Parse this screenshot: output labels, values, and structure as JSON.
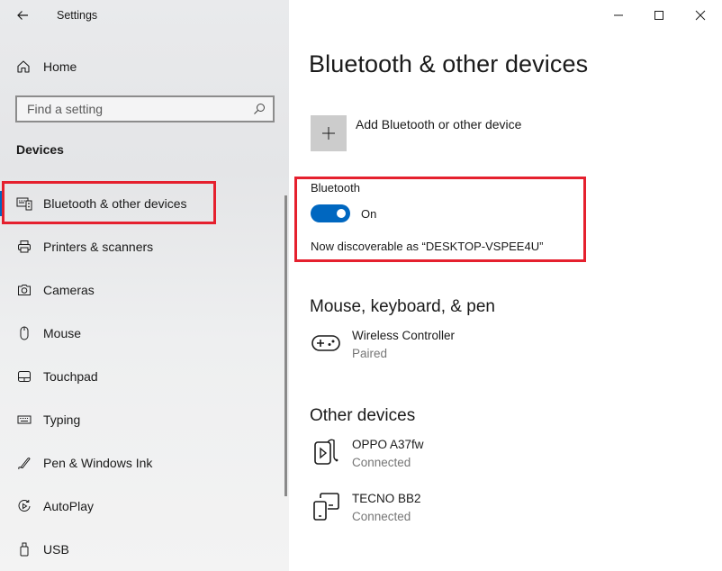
{
  "window": {
    "title": "Settings",
    "controls": {
      "minimize": "minimize",
      "maximize": "maximize",
      "close": "close"
    }
  },
  "sidebar": {
    "home_label": "Home",
    "search": {
      "placeholder": "Find a setting",
      "value": ""
    },
    "section_label": "Devices",
    "items": [
      {
        "label": "Bluetooth & other devices",
        "icon": "bluetooth-devices-icon",
        "selected": true
      },
      {
        "label": "Printers & scanners",
        "icon": "printer-icon"
      },
      {
        "label": "Cameras",
        "icon": "camera-icon"
      },
      {
        "label": "Mouse",
        "icon": "mouse-icon"
      },
      {
        "label": "Touchpad",
        "icon": "touchpad-icon"
      },
      {
        "label": "Typing",
        "icon": "keyboard-icon"
      },
      {
        "label": "Pen & Windows Ink",
        "icon": "pen-icon"
      },
      {
        "label": "AutoPlay",
        "icon": "autoplay-icon"
      },
      {
        "label": "USB",
        "icon": "usb-icon"
      }
    ]
  },
  "main": {
    "title": "Bluetooth & other devices",
    "add_device_label": "Add Bluetooth or other device",
    "bluetooth": {
      "label": "Bluetooth",
      "toggle_on": true,
      "toggle_state": "On",
      "discoverable_text": "Now discoverable as “DESKTOP-VSPEE4U”"
    },
    "sections": [
      {
        "heading": "Mouse, keyboard, & pen",
        "devices": [
          {
            "name": "Wireless Controller",
            "status": "Paired",
            "icon": "gamepad-icon"
          }
        ]
      },
      {
        "heading": "Other devices",
        "devices": [
          {
            "name": "OPPO A37fw",
            "status": "Connected",
            "icon": "media-device-icon"
          },
          {
            "name": "TECNO BB2",
            "status": "Connected",
            "icon": "phone-display-icon"
          }
        ]
      }
    ]
  },
  "colors": {
    "accent": "#0067c0",
    "annotation_red": "#e5202e",
    "secondary_text": "#767676"
  }
}
